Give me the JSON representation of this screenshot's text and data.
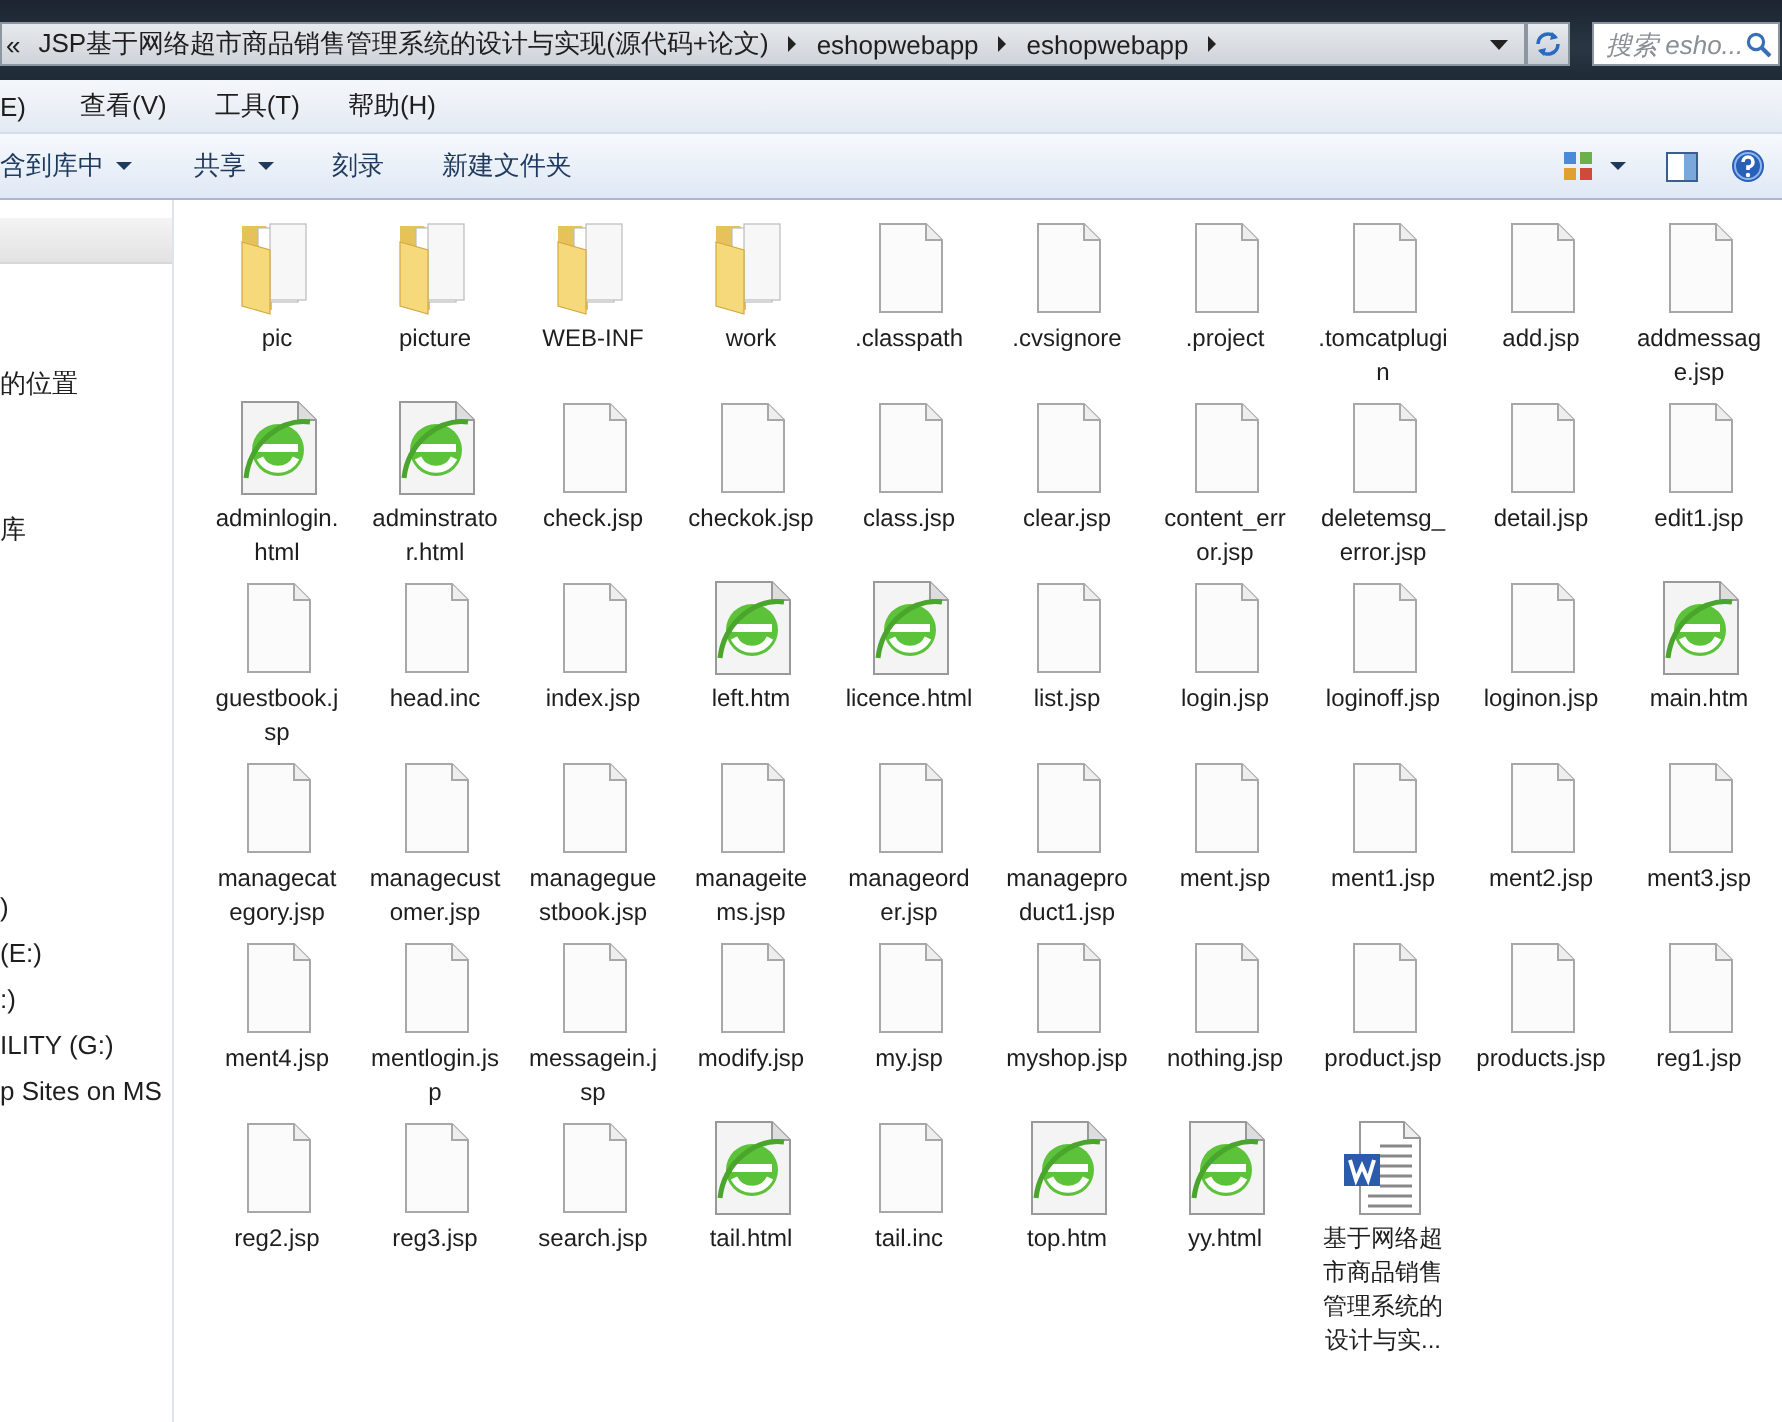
{
  "address_bar": {
    "overflow": "«",
    "breadcrumbs": [
      "JSP基于网络超市商品销售管理系统的设计与实现(源代码+论文)",
      "eshopwebapp",
      "eshopwebapp"
    ]
  },
  "search": {
    "placeholder": "搜索 esho..."
  },
  "menu": [
    "E)",
    "查看(V)",
    "工具(T)",
    "帮助(H)"
  ],
  "toolbar": [
    {
      "label": "含到库中",
      "dropdown": true
    },
    {
      "label": "共享",
      "dropdown": true
    },
    {
      "label": "刻录",
      "dropdown": false
    },
    {
      "label": "新建文件夹",
      "dropdown": false
    }
  ],
  "sidebar": {
    "groups": [
      {
        "items": [
          "的位置"
        ]
      },
      {
        "items": [
          "库"
        ]
      },
      {
        "items": [
          ")",
          "(E:)",
          ":)",
          "ILITY (G:)",
          "p Sites on MS"
        ]
      }
    ]
  },
  "files": [
    {
      "name": "pic",
      "kind": "folder"
    },
    {
      "name": "picture",
      "kind": "folder"
    },
    {
      "name": "WEB-INF",
      "kind": "folder"
    },
    {
      "name": "work",
      "kind": "folder"
    },
    {
      "name": ".classpath",
      "kind": "file"
    },
    {
      "name": ".cvsignore",
      "kind": "file"
    },
    {
      "name": ".project",
      "kind": "file"
    },
    {
      "name": ".tomcatplugin",
      "kind": "file"
    },
    {
      "name": "add.jsp",
      "kind": "file"
    },
    {
      "name": "addmessage.jsp",
      "kind": "file"
    },
    {
      "name": "adminlogin.html",
      "kind": "web"
    },
    {
      "name": "adminstrator.html",
      "kind": "web"
    },
    {
      "name": "check.jsp",
      "kind": "file"
    },
    {
      "name": "checkok.jsp",
      "kind": "file"
    },
    {
      "name": "class.jsp",
      "kind": "file"
    },
    {
      "name": "clear.jsp",
      "kind": "file"
    },
    {
      "name": "content_error.jsp",
      "kind": "file"
    },
    {
      "name": "deletemsg_error.jsp",
      "kind": "file"
    },
    {
      "name": "detail.jsp",
      "kind": "file"
    },
    {
      "name": "edit1.jsp",
      "kind": "file"
    },
    {
      "name": "guestbook.jsp",
      "kind": "file"
    },
    {
      "name": "head.inc",
      "kind": "file"
    },
    {
      "name": "index.jsp",
      "kind": "file"
    },
    {
      "name": "left.htm",
      "kind": "web"
    },
    {
      "name": "licence.html",
      "kind": "web"
    },
    {
      "name": "list.jsp",
      "kind": "file"
    },
    {
      "name": "login.jsp",
      "kind": "file"
    },
    {
      "name": "loginoff.jsp",
      "kind": "file"
    },
    {
      "name": "loginon.jsp",
      "kind": "file"
    },
    {
      "name": "main.htm",
      "kind": "web"
    },
    {
      "name": "managecategory.jsp",
      "kind": "file"
    },
    {
      "name": "managecustomer.jsp",
      "kind": "file"
    },
    {
      "name": "manageguestbook.jsp",
      "kind": "file"
    },
    {
      "name": "manageitems.jsp",
      "kind": "file"
    },
    {
      "name": "manageorder.jsp",
      "kind": "file"
    },
    {
      "name": "manageproduct1.jsp",
      "kind": "file"
    },
    {
      "name": "ment.jsp",
      "kind": "file"
    },
    {
      "name": "ment1.jsp",
      "kind": "file"
    },
    {
      "name": "ment2.jsp",
      "kind": "file"
    },
    {
      "name": "ment3.jsp",
      "kind": "file"
    },
    {
      "name": "ment4.jsp",
      "kind": "file"
    },
    {
      "name": "mentlogin.jsp",
      "kind": "file"
    },
    {
      "name": "messagein.jsp",
      "kind": "file"
    },
    {
      "name": "modify.jsp",
      "kind": "file"
    },
    {
      "name": "my.jsp",
      "kind": "file"
    },
    {
      "name": "myshop.jsp",
      "kind": "file"
    },
    {
      "name": "nothing.jsp",
      "kind": "file"
    },
    {
      "name": "product.jsp",
      "kind": "file"
    },
    {
      "name": "products.jsp",
      "kind": "file"
    },
    {
      "name": "reg1.jsp",
      "kind": "file"
    },
    {
      "name": "reg2.jsp",
      "kind": "file"
    },
    {
      "name": "reg3.jsp",
      "kind": "file"
    },
    {
      "name": "search.jsp",
      "kind": "file"
    },
    {
      "name": "tail.html",
      "kind": "web"
    },
    {
      "name": "tail.inc",
      "kind": "file"
    },
    {
      "name": "top.htm",
      "kind": "web"
    },
    {
      "name": "yy.html",
      "kind": "web"
    },
    {
      "name": "基于网络超市商品销售管理系统的设计与实...",
      "kind": "word"
    }
  ]
}
